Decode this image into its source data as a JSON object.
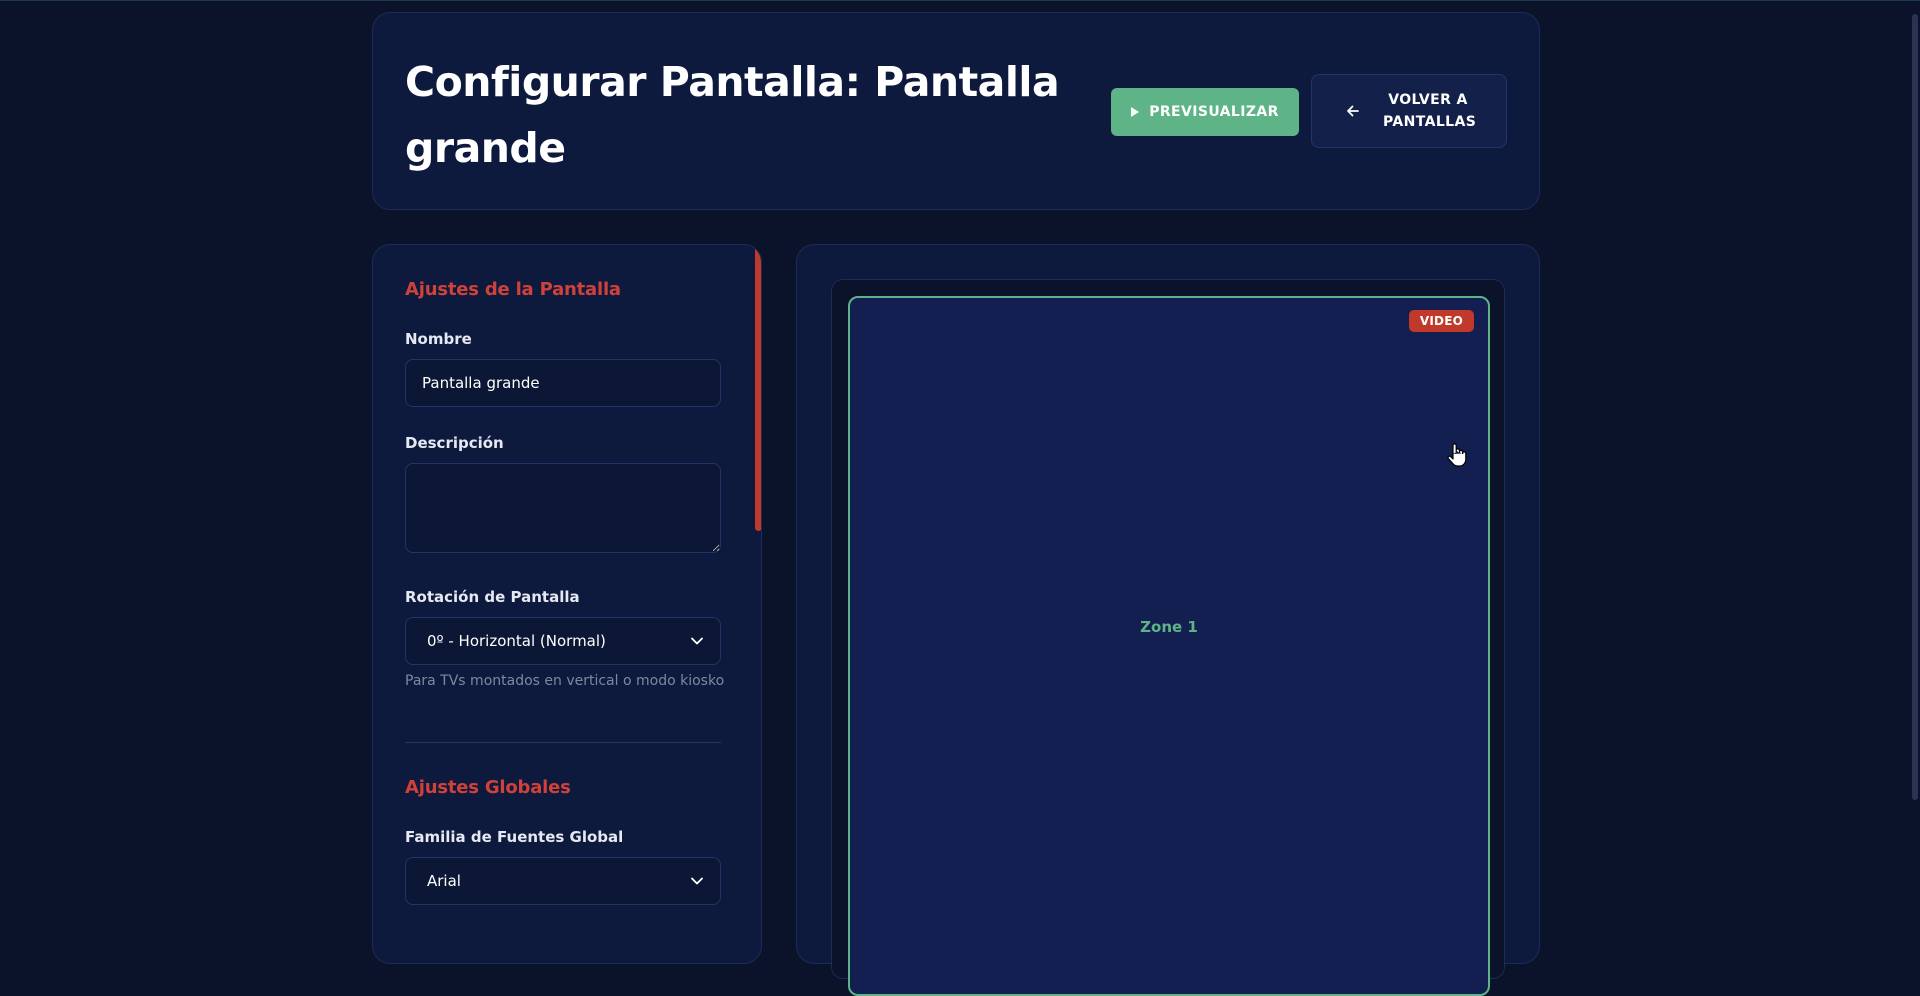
{
  "header": {
    "title": "Configurar Pantalla: Pantalla grande",
    "preview_label": "PREVISUALIZAR",
    "back_label": "VOLVER A PANTALLAS"
  },
  "settings": {
    "screen_section_title": "Ajustes de la Pantalla",
    "name_label": "Nombre",
    "name_value": "Pantalla grande",
    "description_label": "Descripción",
    "description_value": "",
    "rotation_label": "Rotación de Pantalla",
    "rotation_value": "0º - Horizontal (Normal)",
    "rotation_help": "Para TVs montados en vertical o modo kiosko",
    "global_section_title": "Ajustes Globales",
    "font_family_label": "Familia de Fuentes Global",
    "font_family_value": "Arial"
  },
  "preview": {
    "zone_badge": "VIDEO",
    "zone_label": "Zone 1"
  },
  "icons": {
    "preview": "play-icon",
    "back": "arrow-left-icon",
    "select": "chevron-down-icon",
    "cursor": "hand-pointer-icon"
  },
  "colors": {
    "background": "#0a1329",
    "card": "#0e1a3d",
    "accent_red": "#c0392b",
    "accent_green": "#5fb487",
    "zone_fill": "#121f50"
  }
}
